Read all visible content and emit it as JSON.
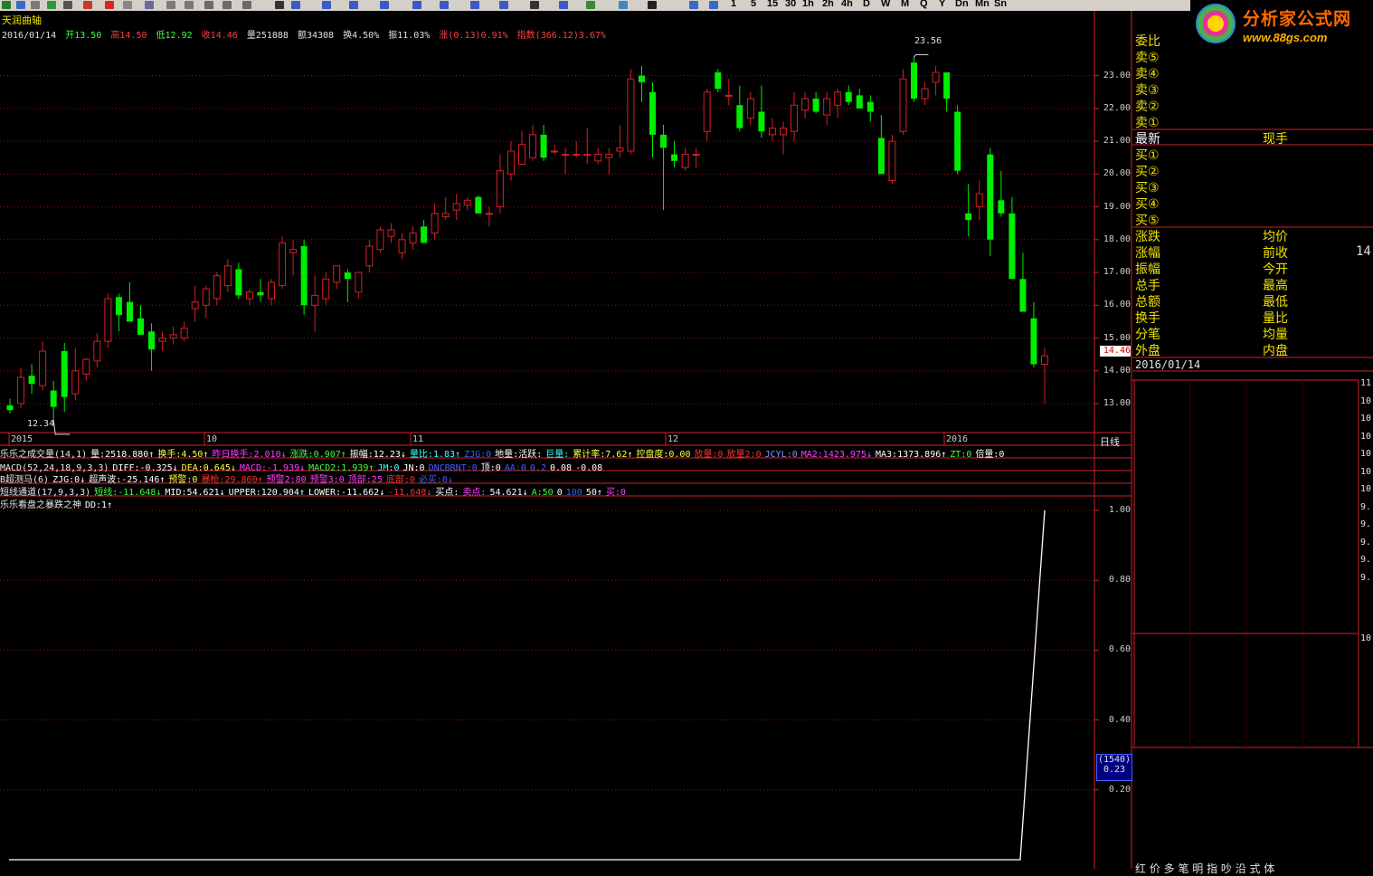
{
  "toolbar": {
    "periods": [
      "1",
      "5",
      "15",
      "30",
      "1h",
      "2h",
      "4h",
      "D",
      "W",
      "M",
      "Q",
      "Y",
      "Dn",
      "Mn",
      "Sn"
    ]
  },
  "logo": {
    "name": "分析家公式网",
    "url": "www.88gs.com"
  },
  "main": {
    "indicator_title": "天润曲轴",
    "date": "2016/01/14",
    "open": "开13.50",
    "high": "高14.50",
    "low": "低12.92",
    "close": "收14.46",
    "volume": "量251888",
    "amount": "额34308",
    "turnover": "换4.50%",
    "amplitude": "振11.03%",
    "change": "涨(0.13)0.91%",
    "index": "指数(366.12)3.67%",
    "period_label": "日线",
    "high_mark": "23.56",
    "low_mark": "12.34",
    "price_tag": "14.46"
  },
  "chart_data": [
    {
      "type": "candlestick",
      "title": "天润曲轴",
      "y_ticks": [
        "23.00",
        "22.00",
        "21.00",
        "20.00",
        "19.00",
        "18.00",
        "17.00",
        "16.00",
        "15.00",
        "14.00",
        "13.00"
      ],
      "ylim": [
        12.2,
        23.9
      ],
      "x_ticks": [
        "2015",
        "10",
        "11",
        "12",
        "2016"
      ],
      "ohlc": [
        [
          12.95,
          13.15,
          12.7,
          12.8
        ],
        [
          13.0,
          14.1,
          12.85,
          13.8
        ],
        [
          13.85,
          14.2,
          13.3,
          13.6
        ],
        [
          13.55,
          14.9,
          13.4,
          14.6
        ],
        [
          13.4,
          13.7,
          12.5,
          12.9
        ],
        [
          14.6,
          14.85,
          12.75,
          13.2
        ],
        [
          13.3,
          14.7,
          13.1,
          14.0
        ],
        [
          13.9,
          14.4,
          13.7,
          14.35
        ],
        [
          14.3,
          15.15,
          14.1,
          14.9
        ],
        [
          14.9,
          16.35,
          14.7,
          16.2
        ],
        [
          16.25,
          16.35,
          15.2,
          15.7
        ],
        [
          16.1,
          16.7,
          15.6,
          15.5
        ],
        [
          15.6,
          16.0,
          15.2,
          15.1
        ],
        [
          15.2,
          15.45,
          14.0,
          14.65
        ],
        [
          14.9,
          15.2,
          14.6,
          15.0
        ],
        [
          15.0,
          15.35,
          14.8,
          15.1
        ],
        [
          15.0,
          15.5,
          14.9,
          15.3
        ],
        [
          15.9,
          16.6,
          15.5,
          16.1
        ],
        [
          16.0,
          16.6,
          15.6,
          16.5
        ],
        [
          16.2,
          17.0,
          16.0,
          16.9
        ],
        [
          16.6,
          17.4,
          16.4,
          17.2
        ],
        [
          17.1,
          17.3,
          16.2,
          16.3
        ],
        [
          16.2,
          16.5,
          16.0,
          16.4
        ],
        [
          16.4,
          16.8,
          16.1,
          16.3
        ],
        [
          16.2,
          16.8,
          16.0,
          16.7
        ],
        [
          16.6,
          18.1,
          16.5,
          17.9
        ],
        [
          17.6,
          18.0,
          16.9,
          17.7
        ],
        [
          17.8,
          18.0,
          15.7,
          16.0
        ],
        [
          16.0,
          16.9,
          15.2,
          16.3
        ],
        [
          16.2,
          17.0,
          16.0,
          16.8
        ],
        [
          16.7,
          17.2,
          16.5,
          17.2
        ],
        [
          17.0,
          17.1,
          16.1,
          16.8
        ],
        [
          16.4,
          17.0,
          16.2,
          17.0
        ],
        [
          17.2,
          18.0,
          17.0,
          17.8
        ],
        [
          17.7,
          18.4,
          17.6,
          18.3
        ],
        [
          18.1,
          18.5,
          17.9,
          18.3
        ],
        [
          17.6,
          18.2,
          17.4,
          18.0
        ],
        [
          17.9,
          18.4,
          17.7,
          18.2
        ],
        [
          18.4,
          18.6,
          17.9,
          17.9
        ],
        [
          18.2,
          19.1,
          18.0,
          18.8
        ],
        [
          18.7,
          19.3,
          18.6,
          18.8
        ],
        [
          18.9,
          19.4,
          18.6,
          19.1
        ],
        [
          19.05,
          19.3,
          18.9,
          19.2
        ],
        [
          19.3,
          19.35,
          18.8,
          18.8
        ],
        [
          18.8,
          19.0,
          18.4,
          18.8
        ],
        [
          19.0,
          20.6,
          18.8,
          20.1
        ],
        [
          20.0,
          21.0,
          19.8,
          20.7
        ],
        [
          20.3,
          21.3,
          20.3,
          20.9
        ],
        [
          20.5,
          21.5,
          20.4,
          21.2
        ],
        [
          21.2,
          21.5,
          20.4,
          20.5
        ],
        [
          20.7,
          20.9,
          20.6,
          20.7
        ],
        [
          20.6,
          20.8,
          20.0,
          20.6
        ],
        [
          20.6,
          21.0,
          20.5,
          20.6
        ],
        [
          20.6,
          21.4,
          20.3,
          20.6
        ],
        [
          20.4,
          20.8,
          20.3,
          20.6
        ],
        [
          20.5,
          20.8,
          20.0,
          20.6
        ],
        [
          20.7,
          21.5,
          20.5,
          20.8
        ],
        [
          20.7,
          23.2,
          20.6,
          22.9
        ],
        [
          23.0,
          23.3,
          22.2,
          22.8
        ],
        [
          22.5,
          22.8,
          20.5,
          21.2
        ],
        [
          21.2,
          21.5,
          18.9,
          20.8
        ],
        [
          20.6,
          21.0,
          20.2,
          20.4
        ],
        [
          20.2,
          20.8,
          20.1,
          20.6
        ],
        [
          20.6,
          20.8,
          20.2,
          20.6
        ],
        [
          21.3,
          22.6,
          21.0,
          22.5
        ],
        [
          23.1,
          23.2,
          22.5,
          22.6
        ],
        [
          22.4,
          22.9,
          22.1,
          22.4
        ],
        [
          22.1,
          22.7,
          21.3,
          21.4
        ],
        [
          21.7,
          22.5,
          21.5,
          22.3
        ],
        [
          21.9,
          22.7,
          21.1,
          21.3
        ],
        [
          21.2,
          21.7,
          21.0,
          21.4
        ],
        [
          21.2,
          21.6,
          20.6,
          21.4
        ],
        [
          21.3,
          22.5,
          21.0,
          22.1
        ],
        [
          21.95,
          22.5,
          21.7,
          22.3
        ],
        [
          22.3,
          22.5,
          21.85,
          21.9
        ],
        [
          21.8,
          22.5,
          21.5,
          22.3
        ],
        [
          22.1,
          22.6,
          21.7,
          22.5
        ],
        [
          22.5,
          22.7,
          22.1,
          22.2
        ],
        [
          22.4,
          22.6,
          22.05,
          22.0
        ],
        [
          22.2,
          22.4,
          21.6,
          21.9
        ],
        [
          21.1,
          21.8,
          20.1,
          20.0
        ],
        [
          19.8,
          21.2,
          19.7,
          21.0
        ],
        [
          21.3,
          23.2,
          21.2,
          22.9
        ],
        [
          23.4,
          23.56,
          22.2,
          22.3
        ],
        [
          22.3,
          22.8,
          22.1,
          22.6
        ],
        [
          22.8,
          23.3,
          22.4,
          23.1
        ],
        [
          23.1,
          23.1,
          21.9,
          22.3
        ],
        [
          21.9,
          22.1,
          20.0,
          20.1
        ],
        [
          18.8,
          19.7,
          18.1,
          18.6
        ],
        [
          19.0,
          19.8,
          18.6,
          19.4
        ],
        [
          20.6,
          20.8,
          17.5,
          18.0
        ],
        [
          19.2,
          20.1,
          18.7,
          18.8
        ],
        [
          18.8,
          19.3,
          17.3,
          16.8
        ],
        [
          16.8,
          17.6,
          15.8,
          15.8
        ],
        [
          15.6,
          16.1,
          14.1,
          14.2
        ],
        [
          14.2,
          14.7,
          13.0,
          14.46
        ]
      ]
    },
    {
      "type": "line",
      "title": "乐乐看盘之暴跌之神",
      "series": [
        {
          "name": "DD",
          "values_last": [
            0,
            1
          ]
        }
      ],
      "y_ticks": [
        "1.00",
        "0.80",
        "0.60",
        "0.40",
        "0.20"
      ],
      "ylim": [
        0,
        1
      ],
      "value_readout": "(1540)",
      "value_readout2": "0.23"
    }
  ],
  "indicators": [
    {
      "id": "vol",
      "segments": [
        {
          "t": "乐乐之成交量(14,1)",
          "c": "#e8e8e8"
        },
        {
          "t": "量:2518.880↑",
          "c": "#ffffff"
        },
        {
          "t": "换手:4.50↑",
          "c": "#ffff40"
        },
        {
          "t": "昨日换手:2.010↓",
          "c": "#ff40ff"
        },
        {
          "t": "涨跌:0.907↑",
          "c": "#40ff40"
        },
        {
          "t": "振幅:12.23↓",
          "c": "#ffffff"
        },
        {
          "t": "量比:1.83↑",
          "c": "#40ffff"
        },
        {
          "t": "ZJG:0",
          "c": "#4060ff"
        },
        {
          "t": "地量:活跃:",
          "c": "#ffffff"
        },
        {
          "t": "巨量:",
          "c": "#40ffff"
        },
        {
          "t": "累计率:7.62↑",
          "c": "#ffff40"
        },
        {
          "t": "控盘度:0.00",
          "c": "#ffff40"
        },
        {
          "t": "放量:0",
          "c": "#ff3030"
        },
        {
          "t": "放量2:0",
          "c": "#ff3030"
        },
        {
          "t": "JCYL:0",
          "c": "#9090ff"
        },
        {
          "t": "MA2:1423.975↓",
          "c": "#ff40ff"
        },
        {
          "t": "MA3:1373.896↑",
          "c": "#ffffff"
        },
        {
          "t": "ZT:0",
          "c": "#40ff40"
        },
        {
          "t": "倍量:0",
          "c": "#ffffff"
        }
      ]
    },
    {
      "id": "macd",
      "segments": [
        {
          "t": "MACD(52,24,18,9,3,3)",
          "c": "#e8e8e8"
        },
        {
          "t": "DIFF:-0.325↓",
          "c": "#ffffff"
        },
        {
          "t": "DEA:0.645↓",
          "c": "#ffff40"
        },
        {
          "t": "MACD:-1.939↓",
          "c": "#ff40ff"
        },
        {
          "t": "MACD2:1.939↑",
          "c": "#40ff40"
        },
        {
          "t": "JM:0",
          "c": "#40ffff"
        },
        {
          "t": "JN:0",
          "c": "#ffffff"
        },
        {
          "t": "DNCBRNT:0",
          "c": "#4060ff"
        },
        {
          "t": "顶:0",
          "c": "#ffffff"
        },
        {
          "t": "AA:0",
          "c": "#4060ff"
        },
        {
          "t": "0.2",
          "c": "#4060ff"
        },
        {
          "t": "0.08",
          "c": "#ffffff"
        },
        {
          "t": "-0.08",
          "c": "#ffffff"
        }
      ]
    },
    {
      "id": "bcm",
      "segments": [
        {
          "t": "B超测马(6)",
          "c": "#e8e8e8"
        },
        {
          "t": "ZJG:0↓",
          "c": "#ffffff"
        },
        {
          "t": "超声波:-25.146↑",
          "c": "#ffffff"
        },
        {
          "t": "预警:0",
          "c": "#ffff40"
        },
        {
          "t": "暴枪:29.860↑",
          "c": "#ff3030"
        },
        {
          "t": "预警2:80",
          "c": "#ff40ff"
        },
        {
          "t": "预警3:0",
          "c": "#ff40ff"
        },
        {
          "t": "顶部:25",
          "c": "#ff40ff"
        },
        {
          "t": "底部:0",
          "c": "#ff3030"
        },
        {
          "t": "必买:0↓",
          "c": "#4060ff"
        }
      ]
    },
    {
      "id": "dxtd",
      "segments": [
        {
          "t": "短线通道(17,9,3,3)",
          "c": "#e8e8e8"
        },
        {
          "t": "短线:-11.648↓",
          "c": "#40ff40"
        },
        {
          "t": "MID:54.621↓",
          "c": "#ffffff"
        },
        {
          "t": "UPPER:120.904↑",
          "c": "#ffffff"
        },
        {
          "t": "LOWER:-11.662↓",
          "c": "#ffffff"
        },
        {
          "t": "-11.648↓",
          "c": "#ff3030"
        },
        {
          "t": "买点:",
          "c": "#ffffff"
        },
        {
          "t": "卖点:",
          "c": "#ff40ff"
        },
        {
          "t": "54.621↓",
          "c": "#ffffff"
        },
        {
          "t": "A:50",
          "c": "#40ff40"
        },
        {
          "t": "0",
          "c": "#ffffff"
        },
        {
          "t": "100",
          "c": "#4060ff"
        },
        {
          "t": "50↑",
          "c": "#ffffff"
        },
        {
          "t": "买:0",
          "c": "#ff40ff"
        }
      ]
    },
    {
      "id": "bdzs",
      "segments": [
        {
          "t": "乐乐看盘之暴跌之神",
          "c": "#e8e8e8"
        },
        {
          "t": "DD:1↑",
          "c": "#ffffff"
        }
      ]
    }
  ],
  "quote_panel": {
    "header": "委比",
    "sell": [
      "卖⑤",
      "卖④",
      "卖③",
      "卖②",
      "卖①"
    ],
    "latest": "最新",
    "current_hand": "现手",
    "buy": [
      "买①",
      "买②",
      "买③",
      "买④",
      "买⑤"
    ],
    "left_labels": [
      "涨跌",
      "涨幅",
      "振幅",
      "总手",
      "总额",
      "换手",
      "分笔",
      "外盘"
    ],
    "right_labels": [
      "均价",
      "前收",
      "今开",
      "最高",
      "最低",
      "量比",
      "均量",
      "内盘"
    ],
    "prev_close_value": "14.",
    "date": "2016/01/14",
    "mini_scale": [
      "11",
      "10",
      "10",
      "10",
      "10",
      "10",
      "10",
      "9.",
      "9.",
      "9.",
      "9.",
      "9.",
      "10"
    ],
    "bottom_tabs": "红 价 多 笔 明 指 吵 沿 式 体"
  }
}
